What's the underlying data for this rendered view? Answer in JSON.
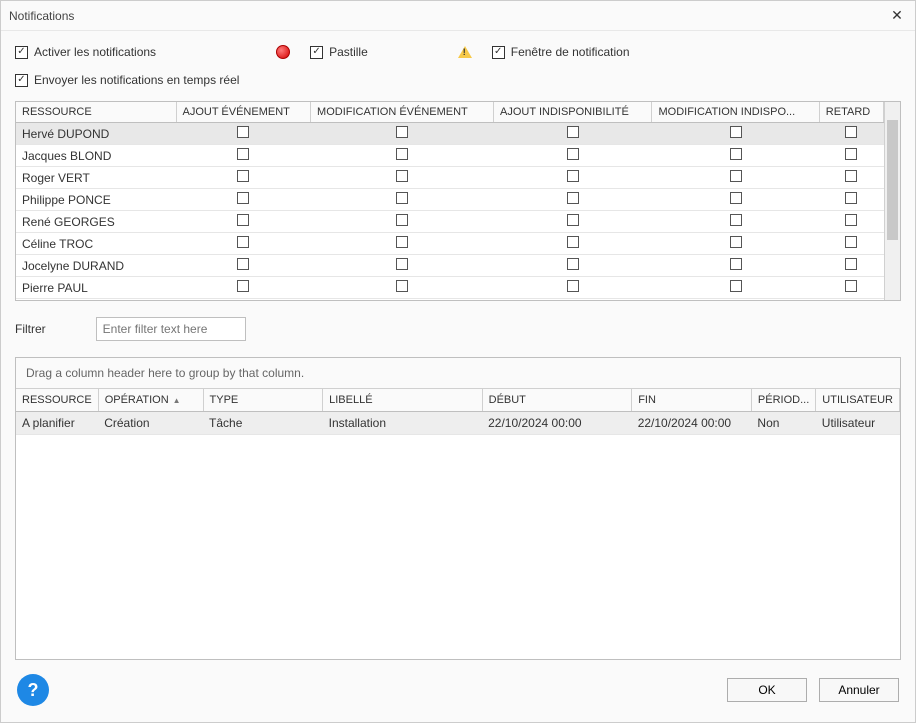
{
  "window": {
    "title": "Notifications"
  },
  "checks": {
    "activate": "Activer les notifications",
    "pastille": "Pastille",
    "fenetre": "Fenêtre de notification",
    "realtime": "Envoyer les notifications en temps réel"
  },
  "grid1": {
    "headers": [
      "RESSOURCE",
      "AJOUT ÉVÉNEMENT",
      "MODIFICATION ÉVÉNEMENT",
      "AJOUT INDISPONIBILITÉ",
      "MODIFICATION INDISPO...",
      "RETARD"
    ],
    "rows": [
      "Hervé DUPOND",
      "Jacques BLOND",
      "Roger VERT",
      "Philippe PONCE",
      "René GEORGES",
      "Céline TROC",
      "Jocelyne DURAND",
      "Pierre PAUL"
    ]
  },
  "filter": {
    "label": "Filtrer",
    "placeholder": "Enter filter text here"
  },
  "grid2": {
    "group_text": "Drag a column header here to group by that column.",
    "headers": [
      "RESSOURCE",
      "OPÉRATION",
      "TYPE",
      "LIBELLÉ",
      "DÉBUT",
      "FIN",
      "PÉRIOD...",
      "UTILISATEUR"
    ],
    "row": {
      "ressource": "A planifier",
      "operation": "Création",
      "type": "Tâche",
      "libelle": "Installation",
      "debut": "22/10/2024 00:00",
      "fin": "22/10/2024 00:00",
      "periode": "Non",
      "utilisateur": "Utilisateur"
    }
  },
  "buttons": {
    "ok": "OK",
    "cancel": "Annuler"
  }
}
